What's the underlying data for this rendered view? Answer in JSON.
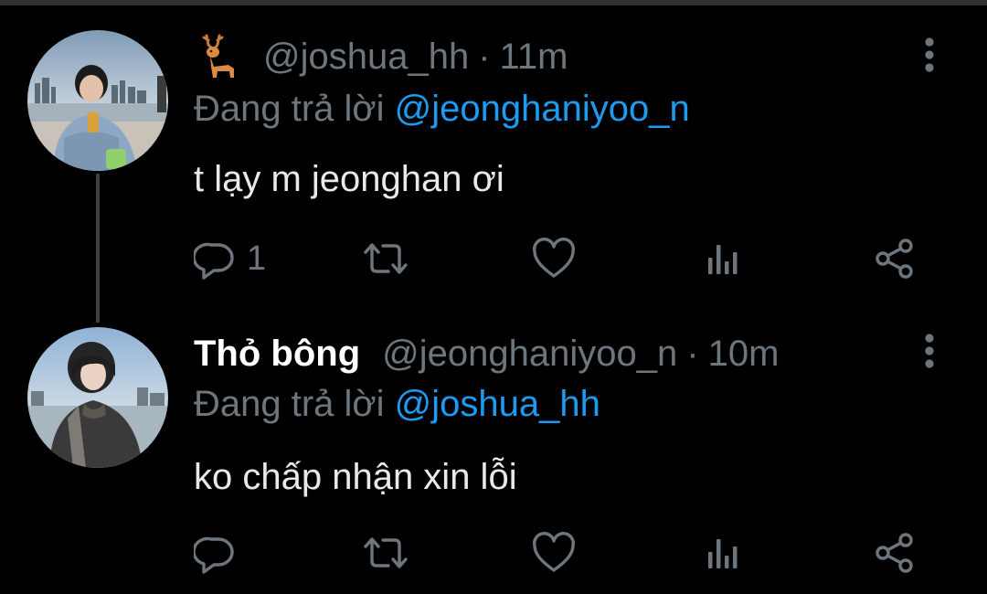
{
  "colors": {
    "background": "#000000",
    "text": "#e7e9ea",
    "secondary_text": "#6e767d",
    "accent_blue": "#1d9bf0",
    "thread_line": "#3d4246"
  },
  "tweets": [
    {
      "display_name_icon": "deer-emoji",
      "handle": "@joshua_hh",
      "separator": "·",
      "time": "11m",
      "reply_prefix": "Đang trả lời",
      "reply_to": "@jeonghaniyoo_n",
      "text": "t lạy m jeonghan ơi",
      "reply_count": "1"
    },
    {
      "display_name": "Thỏ bông",
      "handle": "@jeonghaniyoo_n",
      "separator": "·",
      "time": "10m",
      "reply_prefix": "Đang trả lời",
      "reply_to": "@joshua_hh",
      "text": "ko chấp nhận xin lỗi",
      "reply_count": ""
    }
  ],
  "action_icons": [
    "reply-icon",
    "retweet-icon",
    "like-icon",
    "analytics-icon",
    "share-icon"
  ]
}
